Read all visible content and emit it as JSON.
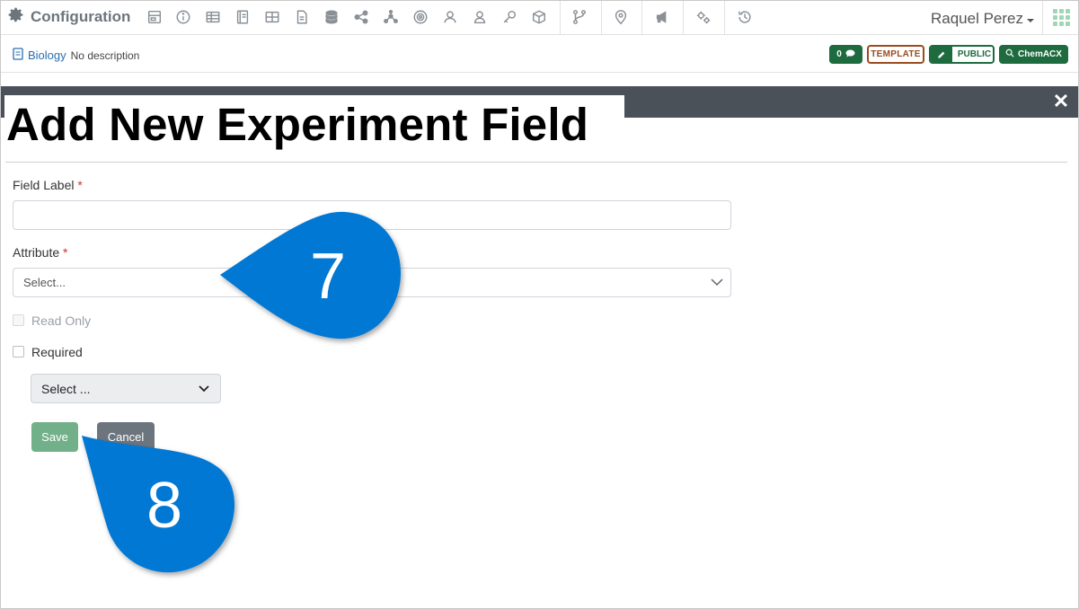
{
  "header": {
    "app_title": "Configuration",
    "user_name": "Raquel Perez",
    "nav_icons": [
      "gear-icon",
      "layout-icon",
      "info-icon",
      "table-icon",
      "notebook-icon",
      "grid-table-icon",
      "document-icon",
      "database-icon",
      "share-icon",
      "network-icon",
      "badge-icon",
      "users-icon",
      "user-icon",
      "key-icon",
      "cube-icon",
      "branch-icon",
      "location-pin-icon",
      "megaphone-icon",
      "cogs-icon",
      "history-icon",
      "apps-grid-icon"
    ]
  },
  "subheader": {
    "collection_name": "Biology",
    "description": "No description",
    "comments_count": "0",
    "template_label": "TEMPLATE",
    "public_label": "PUBLIC",
    "chemacx_label": "ChemACX"
  },
  "modal": {
    "title": "Add New Experiment Field",
    "close_symbol": "✕",
    "field_label": "Field Label",
    "required_mark": "*",
    "field_label_value": "",
    "attribute_label": "Attribute",
    "attribute_placeholder": "Select...",
    "read_only_label": "Read Only",
    "required_label": "Required",
    "required_select_value": "Select ...",
    "save_label": "Save",
    "cancel_label": "Cancel"
  },
  "callouts": {
    "step_7": "7",
    "step_8": "8",
    "color": "#0078d4"
  },
  "colors": {
    "brand_green": "#1e6b3f",
    "template_brown": "#9a4b1f",
    "modal_band": "#4b5159",
    "save_button": "#72b08a",
    "cancel_button": "#6c757d"
  }
}
